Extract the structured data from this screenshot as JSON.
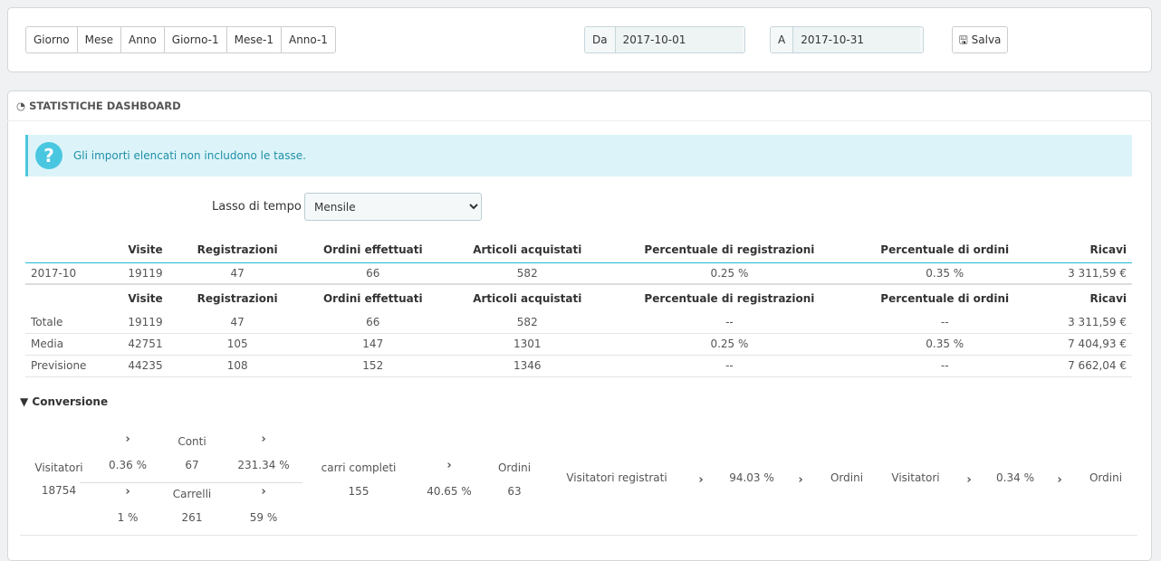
{
  "toolbar": {
    "buttons": [
      "Giorno",
      "Mese",
      "Anno",
      "Giorno-1",
      "Mese-1",
      "Anno-1"
    ],
    "from_label": "Da",
    "from_value": "2017-10-01",
    "to_label": "A",
    "to_value": "2017-10-31",
    "save_label": "Salva"
  },
  "panel": {
    "title": "STATISTICHE DASHBOARD",
    "alert": "Gli importi elencati non includono le tasse.",
    "period_label": "Lasso di tempo",
    "period_value": "Mensile"
  },
  "table": {
    "headers": [
      "",
      "Visite",
      "Registrazioni",
      "Ordini effettuati",
      "Articoli acquistati",
      "Percentuale di registrazioni",
      "Percentuale di ordini",
      "Ricavi"
    ],
    "period_row": [
      "2017-10",
      "19119",
      "47",
      "66",
      "582",
      "0.25 %",
      "0.35 %",
      "3 311,59 €"
    ],
    "summary_rows": [
      [
        "Totale",
        "19119",
        "47",
        "66",
        "582",
        "--",
        "--",
        "3 311,59 €"
      ],
      [
        "Media",
        "42751",
        "105",
        "147",
        "1301",
        "0.25 %",
        "0.35 %",
        "7 404,93 €"
      ],
      [
        "Previsione",
        "44235",
        "108",
        "152",
        "1346",
        "--",
        "--",
        "7 662,04 €"
      ]
    ]
  },
  "conversion": {
    "title": "Conversione",
    "visitors_label": "Visitatori",
    "visitors": "18754",
    "to_accounts_rate": "0.36 %",
    "accounts_label": "Conti",
    "accounts": "67",
    "accounts_to_carts": "231.34 %",
    "to_carts_rate": "1 %",
    "carts_label": "Carrelli",
    "carts": "261",
    "carts_rate": "59 %",
    "full_carts_label": "carri completi",
    "full_carts": "155",
    "full_to_orders": "40.65 %",
    "orders_label": "Ordini",
    "orders": "63",
    "reg_visitors_label": "Visitatori registrati",
    "reg_rate": "94.03 %",
    "reg_orders_label": "Ordini",
    "all_visitors_label": "Visitatori",
    "all_rate": "0.34 %",
    "all_orders_label": "Ordini"
  }
}
